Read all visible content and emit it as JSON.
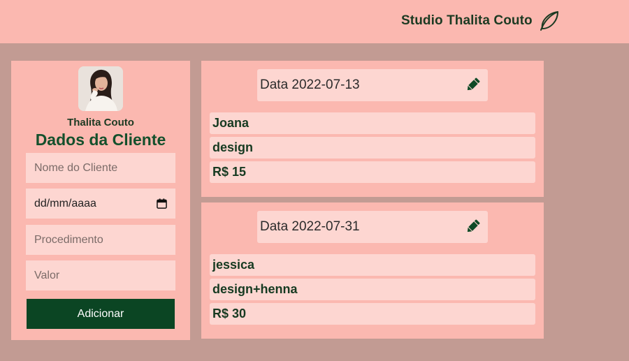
{
  "header": {
    "brand_title": "Studio Thalita Couto",
    "brand_icon": "leaf-icon",
    "background": "#fbb8b0"
  },
  "profile": {
    "name": "Thalita Couto",
    "avatar": "avatar-photo"
  },
  "form": {
    "title": "Dados da Cliente",
    "client_name_placeholder": "Nome do Cliente",
    "date_placeholder": "dd/mm/aaaa",
    "procedure_placeholder": "Procedimento",
    "value_placeholder": "Valor",
    "submit_label": "Adicionar"
  },
  "records": [
    {
      "date_label": "Data 2022-07-13",
      "client": "Joana",
      "procedure": "design",
      "value": "R$ 15"
    },
    {
      "date_label": "Data 2022-07-31",
      "client": "jessica",
      "procedure": "design+henna",
      "value": "R$ 30"
    }
  ],
  "colors": {
    "page_background": "#c29b93",
    "card_background": "#fbb8b0",
    "field_background": "#fdd6d1",
    "button_background": "#0b4523",
    "text_dark_green": "#14502c"
  }
}
